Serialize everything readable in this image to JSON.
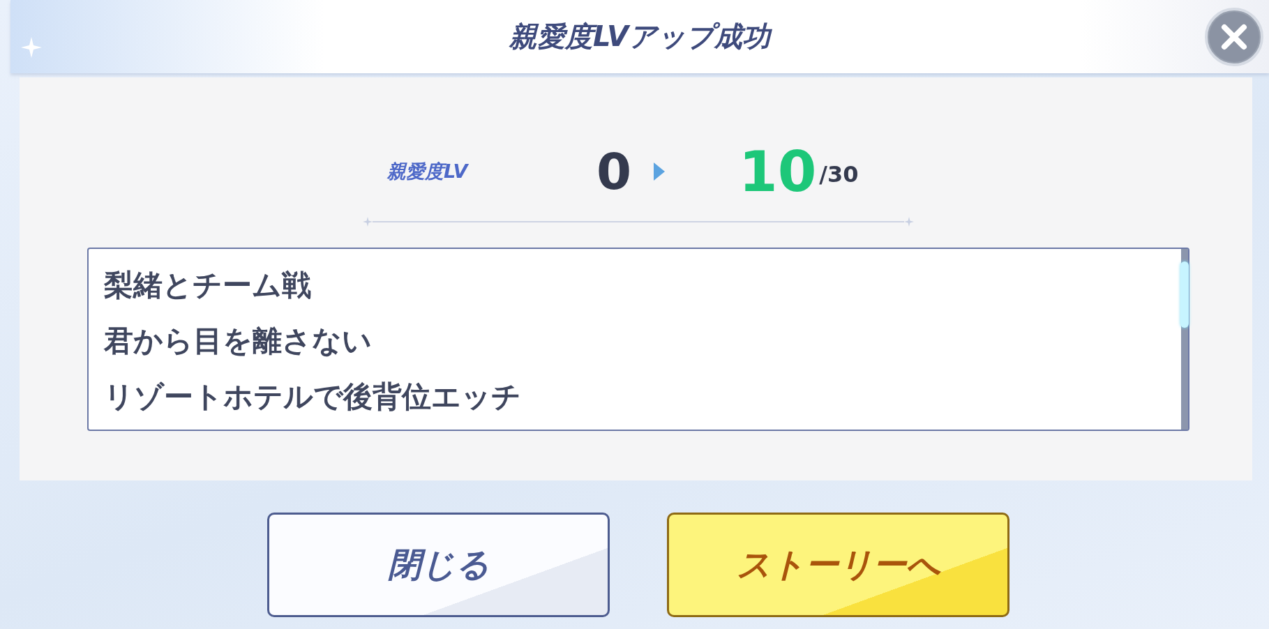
{
  "dialog": {
    "title": "親愛度LVアップ成功"
  },
  "level": {
    "label": "親愛度LV",
    "from": "0",
    "to": "10",
    "max": "/30"
  },
  "stories": [
    "梨緒とチーム戦",
    "君から目を離さない",
    "リゾートホテルで後背位エッチ"
  ],
  "buttons": [
    {
      "label": "閉じる",
      "kind": "secondary"
    },
    {
      "label": "ストーリーへ",
      "kind": "primary"
    }
  ]
}
